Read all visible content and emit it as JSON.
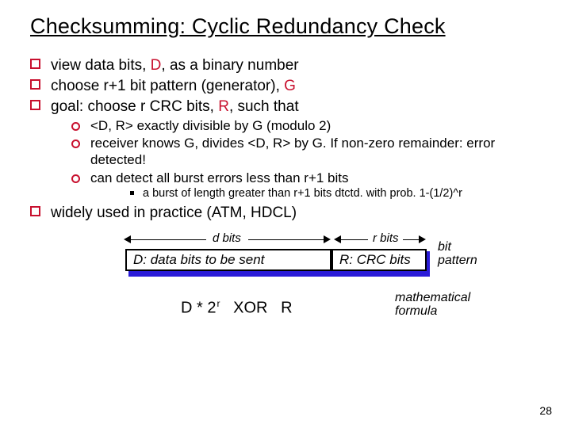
{
  "title": "Checksumming: Cyclic Redundancy Check",
  "b1": {
    "a_pre": "view data bits, ",
    "a_red": "D",
    "a_post": ", as a binary number",
    "b_pre": "choose r+1 bit pattern (generator), ",
    "b_red": "G",
    "c_pre": "goal: choose r CRC bits, ",
    "c_red": "R",
    "c_post": ", such that",
    "d": "widely used in practice (ATM, HDCL)"
  },
  "b2": {
    "a": "<D, R> exactly divisible by G (modulo 2)",
    "b": "receiver knows G, divides <D, R> by G.  If non-zero remainder: error detected!",
    "c": "can detect all burst errors less than r+1 bits"
  },
  "b3": {
    "a": "a burst of length greater than r+1 bits dtctd. with prob. 1-(1/2)^r"
  },
  "diagram": {
    "dbits": "d bits",
    "rbits": "r bits",
    "box1": "D: data bits to be sent",
    "box2": "R: CRC bits",
    "bitpattern1": "bit",
    "bitpattern2": "pattern",
    "expr_d": "D * 2",
    "expr_sup": "r",
    "expr_xor": "   XOR   R",
    "math1": "mathematical",
    "math2": "formula"
  },
  "pagenum": "28"
}
